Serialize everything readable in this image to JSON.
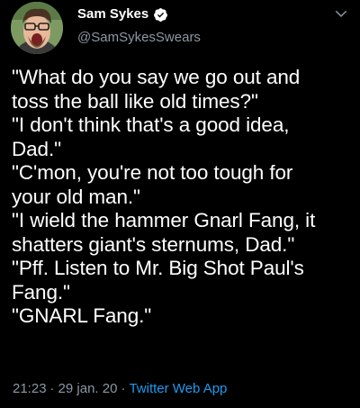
{
  "author": {
    "display_name": "Sam Sykes",
    "handle": "@SamSykesSwears",
    "verified": true,
    "avatar_icon": "profile-photo-avatar"
  },
  "tweet": {
    "lines": [
      "\"What do you say we go out and",
      "toss the ball like old times?\"",
      "\"I don't think that's a good idea,",
      "Dad.\"",
      "\"C'mon, you're not too tough for",
      "your old man.\"",
      "\"I wield the hammer Gnarl Fang, it",
      "shatters giant's sternums, Dad.\"",
      "\"Pff. Listen to Mr. Big Shot Paul's",
      "Fang.\"",
      "\"GNARL Fang.\""
    ]
  },
  "meta": {
    "time": "21:23",
    "separator": "·",
    "date": "29 jan. 20",
    "source": "Twitter Web App"
  },
  "colors": {
    "background": "#000000",
    "text": "#ffffff",
    "secondary_text": "#8b98a5",
    "link": "#1d9bf0",
    "verified_badge": "#ffffff"
  },
  "icons": {
    "verified": "verified-badge-icon",
    "menu": "chevron-down-icon"
  }
}
